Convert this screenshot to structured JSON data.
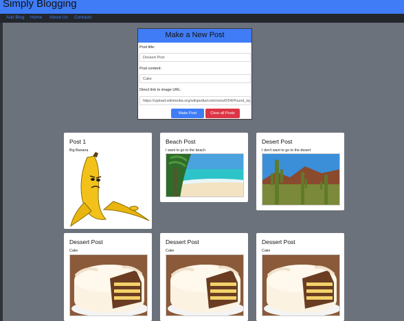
{
  "header": {
    "brand": "Simply Blogging"
  },
  "nav": {
    "items": [
      "Add Blog",
      "Home",
      "About Us",
      "Contacts"
    ]
  },
  "form": {
    "title": "Make a New Post",
    "post_title_label": "Post title:",
    "post_title_value": "Dessert Post",
    "post_content_label": "Post content:",
    "post_content_value": "Cake",
    "image_url_label": "Direct link to image URL:",
    "image_url_value": "https://upload.wikimedia.org/wikipedia/commons/0/04/Pound_layer_c",
    "make_post_label": "Make Post",
    "clear_posts_label": "Clear all Posts",
    "make_post_color": "#3f7cf6",
    "clear_posts_color": "#dc3545"
  },
  "posts": [
    {
      "title": "Post 1",
      "content": "Big Banana"
    },
    {
      "title": "Beach Post",
      "content": "I want to go to the beach"
    },
    {
      "title": "Desert Post",
      "content": "I don't want to go to the desert"
    },
    {
      "title": "Dessert Post",
      "content": "Cake"
    },
    {
      "title": "Dessert Post",
      "content": "Cake"
    },
    {
      "title": "Dessert Post",
      "content": "Cake"
    }
  ]
}
